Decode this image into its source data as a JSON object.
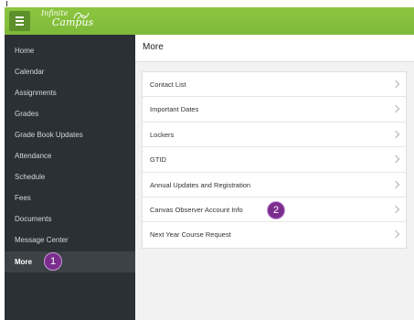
{
  "app": {
    "logo_line1": "Infinite",
    "logo_line2": "Campus",
    "brand_color": "#8cc63f"
  },
  "sidebar": {
    "items": [
      {
        "label": "Home"
      },
      {
        "label": "Calendar"
      },
      {
        "label": "Assignments"
      },
      {
        "label": "Grades"
      },
      {
        "label": "Grade Book Updates"
      },
      {
        "label": "Attendance"
      },
      {
        "label": "Schedule"
      },
      {
        "label": "Fees"
      },
      {
        "label": "Documents"
      },
      {
        "label": "Message Center"
      },
      {
        "label": "More"
      }
    ],
    "active": "More"
  },
  "main": {
    "title": "More",
    "items": [
      {
        "label": "Contact List"
      },
      {
        "label": "Important Dates"
      },
      {
        "label": "Lockers"
      },
      {
        "label": "GTID"
      },
      {
        "label": "Annual Updates and Registration"
      },
      {
        "label": "Canvas Observer Account Info"
      },
      {
        "label": "Next Year Course Request"
      }
    ]
  },
  "annotations": {
    "badge1": "1",
    "badge2": "2",
    "badge_color": "#7b2d8e"
  },
  "icons": {
    "menu": "hamburger-menu-icon",
    "chevron": "chevron-right-icon",
    "logo": "campus-logo-swirl-icon"
  }
}
